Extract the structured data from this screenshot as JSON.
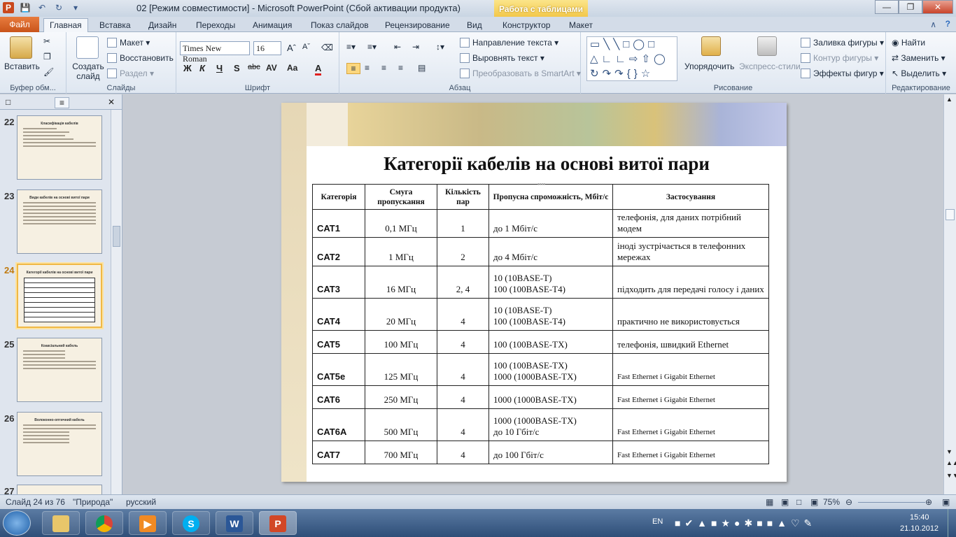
{
  "titlebar": {
    "title": "02 [Режим совместимости]  -  Microsoft PowerPoint (Сбой активации продукта)",
    "context_tab": "Работа с таблицами"
  },
  "tabs": [
    "Файл",
    "Главная",
    "Вставка",
    "Дизайн",
    "Переходы",
    "Анимация",
    "Показ слайдов",
    "Рецензирование",
    "Вид",
    "Конструктор",
    "Макет"
  ],
  "ribbon": {
    "clipboard": {
      "paste": "Вставить",
      "label": "Буфер обм..."
    },
    "slides": {
      "create": "Создать слайд",
      "layout": "Макет",
      "reset": "Восстановить",
      "section": "Раздел",
      "label": "Слайды"
    },
    "font": {
      "name": "Times New Roman",
      "size": "16",
      "label": "Шрифт"
    },
    "paragraph": {
      "text_dir": "Направление текста",
      "align_text": "Выровнять текст",
      "smartart": "Преобразовать в SmartArt",
      "label": "Абзац"
    },
    "drawing": {
      "arrange": "Упорядочить",
      "styles": "Экспресс-стили",
      "fill": "Заливка фигуры",
      "outline": "Контур фигуры",
      "effects": "Эффекты фигур",
      "label": "Рисование"
    },
    "editing": {
      "find": "Найти",
      "replace": "Заменить",
      "select": "Выделить",
      "label": "Редактирование"
    }
  },
  "thumbnails": [
    {
      "num": "22",
      "title": "Класифікація кабелів"
    },
    {
      "num": "23",
      "title": "Види кабелів на основі витої пари"
    },
    {
      "num": "24",
      "title": "Категорії кабелів на основі витої пари"
    },
    {
      "num": "25",
      "title": "Коаксіальний кабель"
    },
    {
      "num": "26",
      "title": "Волоконно-оптичний кабель"
    },
    {
      "num": "27",
      "title": ""
    }
  ],
  "slide": {
    "title": "Категорії кабелів на основі витої пари",
    "headers": [
      "Категорія",
      "Смуга пропускання",
      "Кількість пар",
      "Пропусна спроможність, Мбіт/с",
      "Застосування"
    ],
    "rows": [
      {
        "cat": "CAT1",
        "band": "0,1 МГц",
        "pairs": "1",
        "throughput": "до 1 Мбіт/с",
        "use": "телефонія,  для даних потрібний модем"
      },
      {
        "cat": "CAT2",
        "band": "1 МГц",
        "pairs": "2",
        "throughput": "до 4 Мбіт/с",
        "use": "іноді зустрічається  в телефонних мережах"
      },
      {
        "cat": "CAT3",
        "band": "16 МГц",
        "pairs": "2, 4",
        "throughput": "10 (10BASE-T)\n100 (100BASE-T4)",
        "use": "підходить  для передачі  голосу і даних"
      },
      {
        "cat": "CAT4",
        "band": "20 МГц",
        "pairs": "4",
        "throughput": "10 (10BASE-T)\n100 (100BASE-T4)",
        "use": "практично  не використовується"
      },
      {
        "cat": "CAT5",
        "band": "100 МГц",
        "pairs": "4",
        "throughput": "100 (100BASE-TX)",
        "use": "телефонія,  швидкий Ethernet"
      },
      {
        "cat": "CAT5e",
        "band": "125 МГц",
        "pairs": "4",
        "throughput": "100 (100BASE-TX)\n1000 (1000BASE-TX)",
        "use": "Fast Ethernet і Gigabit  Ethernet"
      },
      {
        "cat": "CAT6",
        "band": "250 МГц",
        "pairs": "4",
        "throughput": "1000 (1000BASE-TX)",
        "use": "Fast Ethernet і Gigabit  Ethernet"
      },
      {
        "cat": "CAT6A",
        "band": "500 МГц",
        "pairs": "4",
        "throughput": "1000 (1000BASE-TX)\nдо 10 Гбіт/с",
        "use": "Fast Ethernet і Gigabit  Ethernet"
      },
      {
        "cat": "CAT7",
        "band": "700 МГц",
        "pairs": "4",
        "throughput": "до 100 Гбіт/с",
        "use": "Fast Ethernet і Gigabit  Ethernet"
      }
    ]
  },
  "status": {
    "slide": "Слайд 24 из 76",
    "theme": "\"Природа\"",
    "lang": "русский",
    "zoom": "75%"
  },
  "taskbar": {
    "lang": "EN",
    "time": "15:40",
    "date": "21.10.2012"
  },
  "colors": {
    "file_tab": "#c9541a",
    "context": "#f2c544",
    "selection": "#f0b845"
  }
}
